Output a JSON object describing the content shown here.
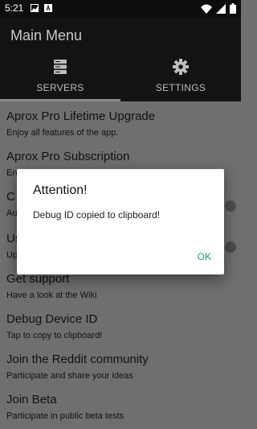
{
  "status_bar": {
    "time": "5:21"
  },
  "app_bar": {
    "title": "Main Menu"
  },
  "tabs": [
    {
      "label": "SERVERS"
    },
    {
      "label": "SETTINGS"
    }
  ],
  "menu": [
    {
      "title": "Aprox Pro Lifetime Upgrade",
      "subtitle": "Enjoy all features of the app."
    },
    {
      "title": "Aprox Pro Subscription",
      "subtitle": "En"
    },
    {
      "title": "C",
      "subtitle": "Au"
    },
    {
      "title": "Us",
      "subtitle": "Up"
    },
    {
      "title": "Get support",
      "subtitle": "Have a look at the Wiki"
    },
    {
      "title": "Debug Device ID",
      "subtitle": "Tap to copy to clipboard!"
    },
    {
      "title": "Join the Reddit community",
      "subtitle": "Participate and share your ideas"
    },
    {
      "title": "Join Beta",
      "subtitle": "Participate in public beta tests"
    }
  ],
  "dialog": {
    "title": "Attention!",
    "message": "Debug ID copied to clipboard!",
    "ok_label": "OK"
  },
  "colors": {
    "accent": "#1aa16a",
    "app_bar": "#111315",
    "scrim_list": "#6f6f6f"
  }
}
